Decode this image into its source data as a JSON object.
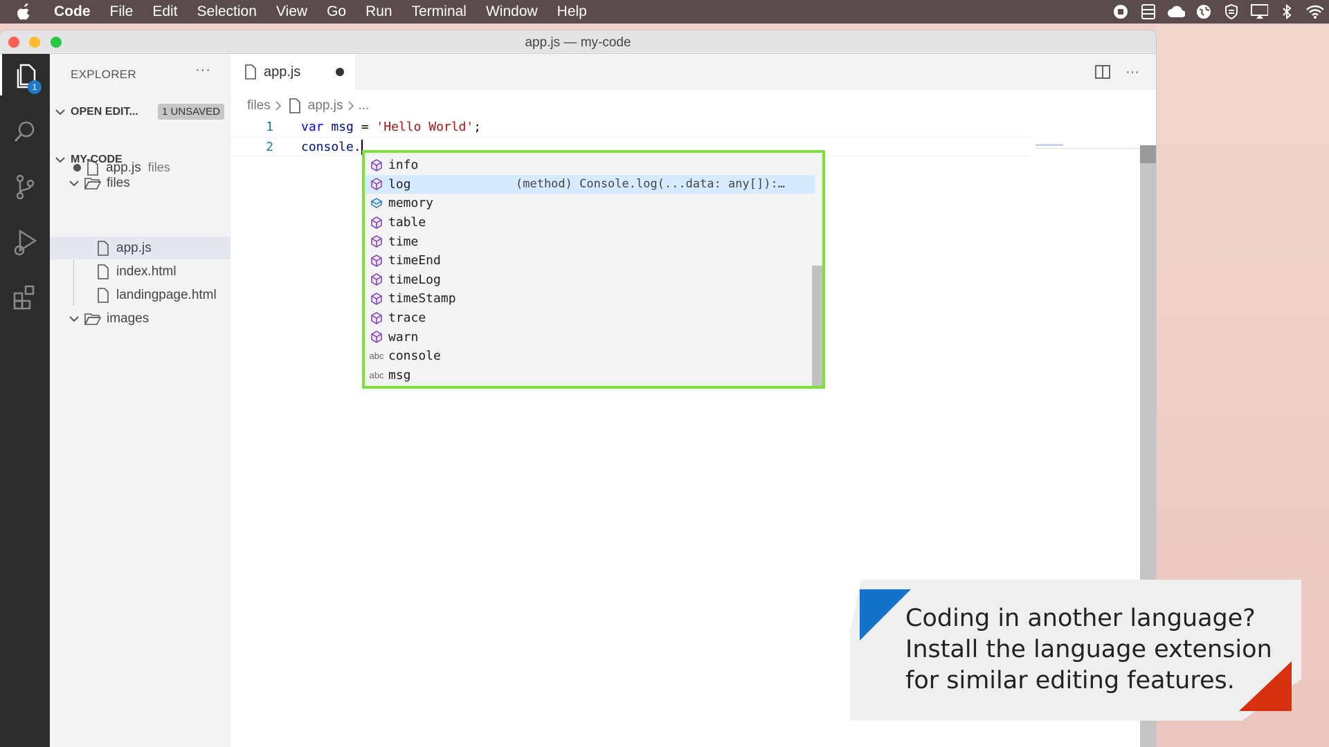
{
  "menubar": {
    "app_name": "Code",
    "items": [
      "File",
      "Edit",
      "Selection",
      "View",
      "Go",
      "Run",
      "Terminal",
      "Window",
      "Help"
    ],
    "tray_icons": [
      "record-icon",
      "storage-icon",
      "cloud-icon",
      "globe-icon",
      "shield-icon",
      "airplay-icon",
      "bluetooth-icon",
      "wifi-icon"
    ]
  },
  "window": {
    "title": "app.js — my-code"
  },
  "activity_bar": {
    "items": [
      "explorer-icon",
      "search-icon",
      "source-control-icon",
      "run-debug-icon",
      "extensions-icon"
    ],
    "explorer_badge": "1"
  },
  "sidebar": {
    "header": "EXPLORER",
    "more": "···",
    "open_editors": {
      "label": "OPEN EDIT...",
      "badge": "1 UNSAVED",
      "file": "app.js",
      "folder": "files"
    },
    "workspace": {
      "label": "MY-CODE",
      "folder_files": "files",
      "files": [
        "app.js",
        "index.html",
        "landingpage.html"
      ],
      "folder_images": "images"
    }
  },
  "editor": {
    "tab_label": "app.js",
    "breadcrumb": [
      "files",
      "app.js",
      "..."
    ],
    "lines": [
      {
        "number": "1",
        "kw": "var",
        "name": " msg ",
        "op": "= ",
        "str": "'Hello World'",
        "end": ";"
      },
      {
        "number": "2",
        "text": "console."
      }
    ]
  },
  "suggest": {
    "items": [
      {
        "label": "info",
        "kind": "method"
      },
      {
        "label": "log",
        "kind": "method",
        "detail": "(method) Console.log(...data: any[]):…"
      },
      {
        "label": "memory",
        "kind": "property"
      },
      {
        "label": "table",
        "kind": "method"
      },
      {
        "label": "time",
        "kind": "method"
      },
      {
        "label": "timeEnd",
        "kind": "method"
      },
      {
        "label": "timeLog",
        "kind": "method"
      },
      {
        "label": "timeStamp",
        "kind": "method"
      },
      {
        "label": "trace",
        "kind": "method"
      },
      {
        "label": "warn",
        "kind": "method"
      },
      {
        "label": "console",
        "kind": "text"
      },
      {
        "label": "msg",
        "kind": "text"
      }
    ],
    "text_kind_icon": "abc",
    "selected_index": 1
  },
  "callout": {
    "lines": [
      "Coding in another language?",
      "Install the language extension",
      "for similar editing features."
    ]
  }
}
